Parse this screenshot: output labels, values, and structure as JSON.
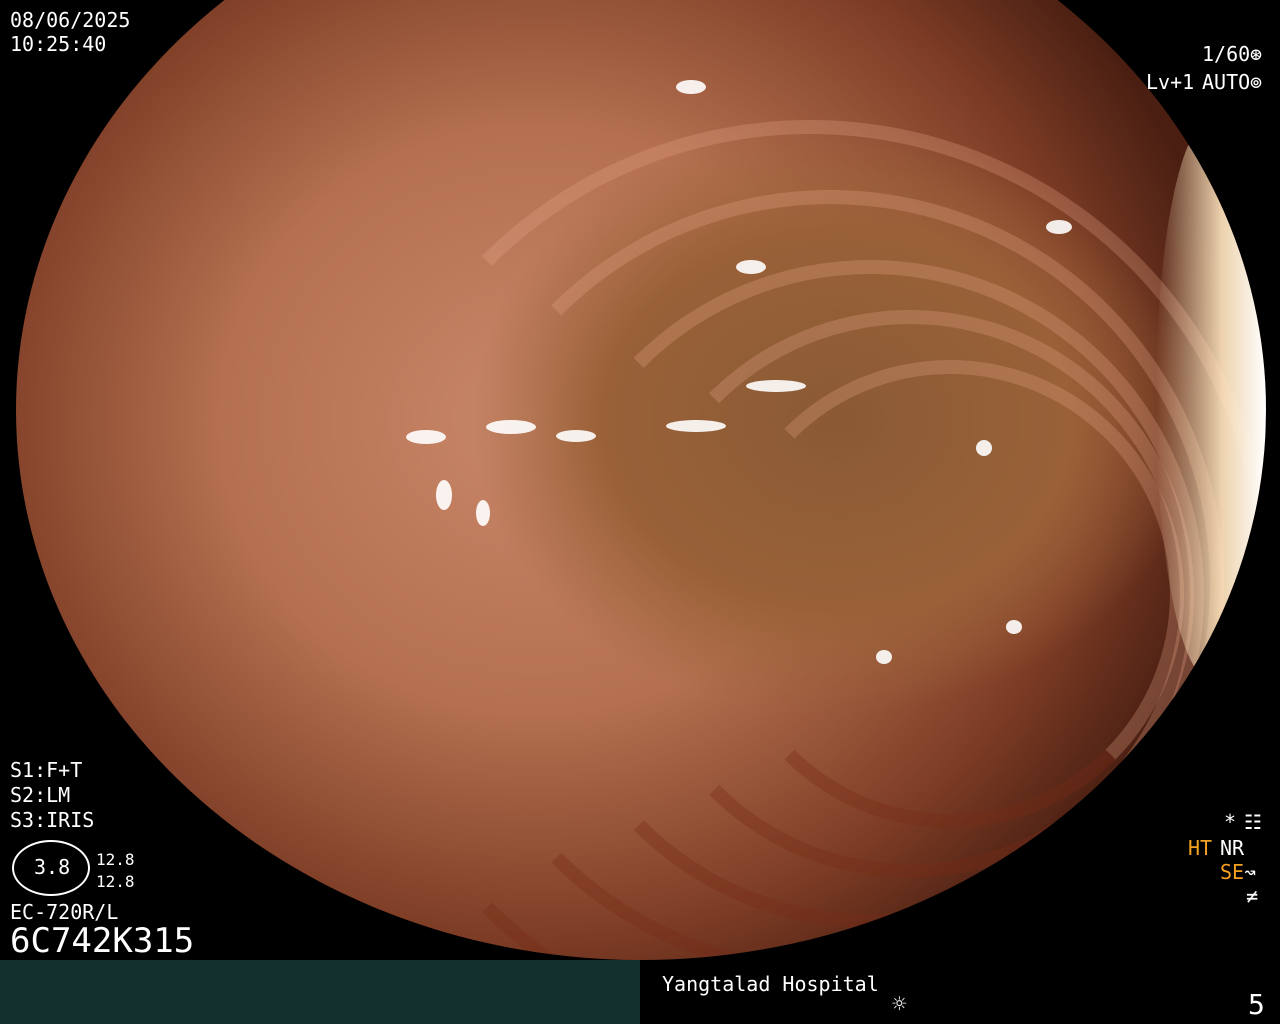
{
  "osd": {
    "date": "08/06/2025",
    "time": "10:25:40",
    "shutter": "1/60",
    "level": "Lv+1",
    "auto": "AUTO",
    "s1": "S1:F+T",
    "s2": "S2:LM",
    "s3": "S3:IRIS",
    "ratio_center": "3.8",
    "ratio_top": "12.8",
    "ratio_bottom": "12.8",
    "scope_model": "EC-720R/L",
    "serial": "6C742K315",
    "ht": "HT",
    "nr": "NR",
    "se": "SE",
    "star": "*",
    "hospital": "Yangtalad Hospital",
    "image_count": "5"
  },
  "colors": {
    "accent_orange": "#f5a020",
    "bar_left": "#13302f"
  },
  "icons": [
    "shutter-icon",
    "auto-icon",
    "settings-icon",
    "se-icon",
    "freeze-icon",
    "brightness-icon"
  ]
}
